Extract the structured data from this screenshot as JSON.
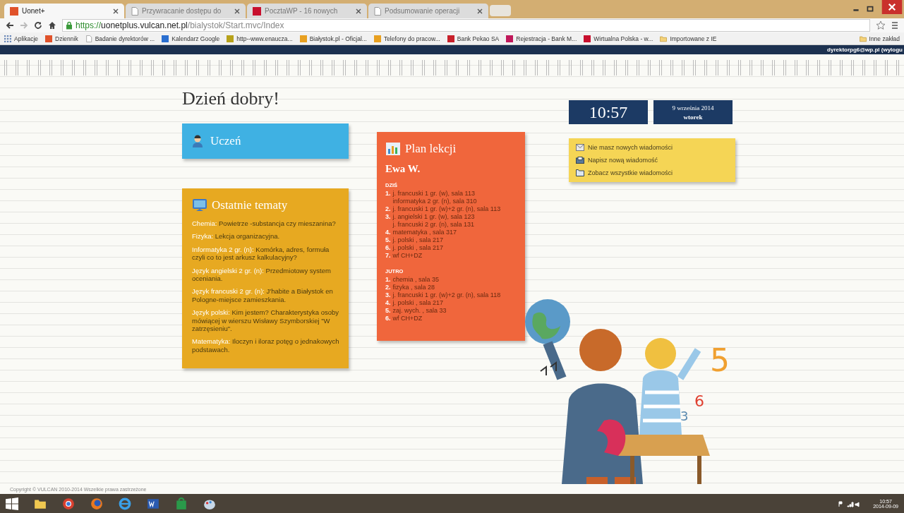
{
  "browser": {
    "tabs": [
      {
        "label": "Uonet+",
        "selected": true,
        "kind": "site",
        "color": "#e0522a"
      },
      {
        "label": "Przywracanie dostępu do",
        "selected": false,
        "kind": "page"
      },
      {
        "label": "PocztaWP - 16 nowych",
        "selected": false,
        "kind": "site",
        "color": "#c8102e"
      },
      {
        "label": "Podsumowanie operacji",
        "selected": false,
        "kind": "page"
      }
    ],
    "url": [
      {
        "text": "https://",
        "kind": "scheme"
      },
      {
        "text": "uonetplus.vulcan.net.pl",
        "kind": "host"
      },
      {
        "text": "/bialystok/Start.mvc/Index",
        "kind": "path"
      }
    ],
    "bookmarks": [
      {
        "label": "Aplikacje",
        "kind": "apps"
      },
      {
        "label": "Dziennik",
        "kind": "site",
        "color": "#e0522a"
      },
      {
        "label": "Badanie dyrektorów ...",
        "kind": "page"
      },
      {
        "label": "Kalendarz Google",
        "kind": "site",
        "color": "#2a6fd0"
      },
      {
        "label": "http--www.enaucza...",
        "kind": "site",
        "color": "#b7a21a"
      },
      {
        "label": "Białystok.pl - Oficjal...",
        "kind": "site",
        "color": "#e8a020"
      },
      {
        "label": "Telefony do pracow...",
        "kind": "site",
        "color": "#e8a020"
      },
      {
        "label": "Bank Pekao SA",
        "kind": "site",
        "color": "#c8202a"
      },
      {
        "label": "Rejestracja - Bank M...",
        "kind": "site",
        "color": "#c0185a"
      },
      {
        "label": "Wirtualna Polska - w...",
        "kind": "site",
        "color": "#c8102e"
      },
      {
        "label": "Importowane z IE",
        "kind": "folder"
      }
    ],
    "other_bookmarks": "Inne zakład"
  },
  "user_bar": {
    "user": "dyrektorpg6@wp.pl (wylogu"
  },
  "greeting": "Dzień dobry!",
  "clock": {
    "time": "10:57",
    "date": "9 września 2014",
    "weekday": "wtorek"
  },
  "student_panel": {
    "title": "Uczeń"
  },
  "topics_panel": {
    "title": "Ostatnie tematy",
    "items": [
      {
        "subject": "Chemia:",
        "topic": "Powietrze -substancja czy mieszanina?"
      },
      {
        "subject": "Fizyka:",
        "topic": "Lekcja organizacyjna."
      },
      {
        "subject": "Informatyka 2 gr. (n):",
        "topic": "Komórka, adres, formuła czyli co to jest arkusz kalkulacyjny?"
      },
      {
        "subject": "Język angielski 2 gr. (n):",
        "topic": "Przedmiotowy system oceniania."
      },
      {
        "subject": "Język francuski 2 gr. (n):",
        "topic": "J'habite a Białystok en Pologne-miejsce zamieszkania."
      },
      {
        "subject": "Język polski:",
        "topic": "Kim jestem? Charakterystyka osoby mówiącej w wierszu Wisławy Szymborskiej \"W zatrzęsieniu\"."
      },
      {
        "subject": "Matematyka:",
        "topic": "Iloczyn i iloraz potęg o jednakowych podstawach."
      }
    ]
  },
  "plan_panel": {
    "title": "Plan lekcji",
    "student": "Ewa W.",
    "days": [
      {
        "label": "DZIŚ",
        "lessons": [
          {
            "number": "1.",
            "lines": [
              "j. francuski 1 gr. (w), sala 113",
              "informatyka 2 gr. (n), sala 310"
            ]
          },
          {
            "number": "2.",
            "lines": [
              "j. francuski 1 gr. (w)+2 gr. (n), sala 113"
            ]
          },
          {
            "number": "3.",
            "lines": [
              "j. angielski 1 gr. (w), sala 123",
              "j. francuski 2 gr. (n), sala 131"
            ]
          },
          {
            "number": "4.",
            "lines": [
              "matematyka , sala 317"
            ]
          },
          {
            "number": "5.",
            "lines": [
              "j. polski , sala 217"
            ]
          },
          {
            "number": "6.",
            "lines": [
              "j. polski , sala 217"
            ]
          },
          {
            "number": "7.",
            "lines": [
              "wf CH+DZ"
            ]
          }
        ]
      },
      {
        "label": "JUTRO",
        "lessons": [
          {
            "number": "1.",
            "lines": [
              "chemia , sala 35"
            ]
          },
          {
            "number": "2.",
            "lines": [
              "fizyka , sala 28"
            ]
          },
          {
            "number": "3.",
            "lines": [
              "j. francuski 1 gr. (w)+2 gr. (n), sala 118"
            ]
          },
          {
            "number": "4.",
            "lines": [
              "j. polski , sala 217"
            ]
          },
          {
            "number": "5.",
            "lines": [
              "zaj. wych. , sala 33"
            ]
          },
          {
            "number": "6.",
            "lines": [
              "wf CH+DZ"
            ]
          }
        ]
      }
    ]
  },
  "messages_panel": {
    "items": [
      {
        "label": "Nie masz nowych wiadomości",
        "kind": "envelope"
      },
      {
        "label": "Napisz nową wiadomość",
        "kind": "compose"
      },
      {
        "label": "Zobacz wszystkie wiadomości",
        "kind": "folder"
      }
    ]
  },
  "illustration": {
    "numbers": [
      "5",
      "6",
      "3"
    ]
  },
  "footer": {
    "copyright": "Copyright © VULCAN 2010-2014 Wszelkie prawa zastrzeżone"
  },
  "taskbar": {
    "time": "10:57",
    "date": "2014-09-09"
  }
}
